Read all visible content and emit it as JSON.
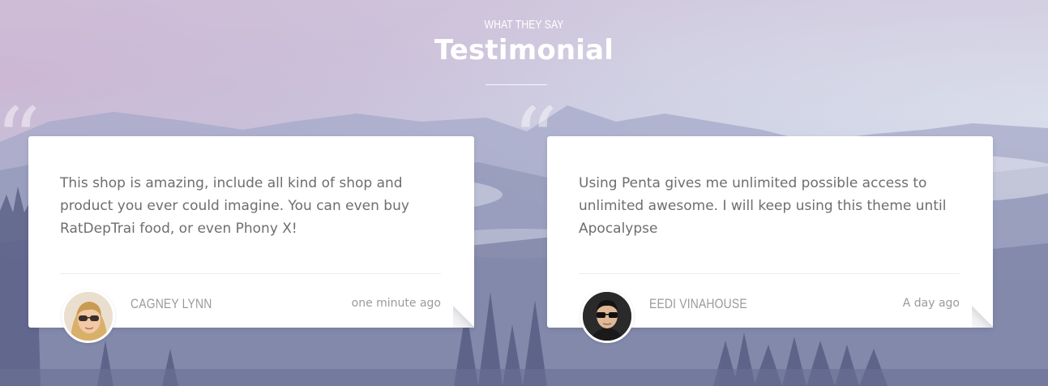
{
  "section": {
    "eyebrow": "WHAT THEY SAY",
    "title": "Testimonial"
  },
  "testimonials": [
    {
      "quote": "This shop is amazing, include all kind of shop and product you ever could imagine. You can even buy RatDepTrai food, or even Phony X!",
      "author": "CAGNEY LYNN",
      "time": "one minute ago",
      "avatar_icon": "woman-avatar"
    },
    {
      "quote": "Using Penta gives me unlimited possible access to unlimited awesome. I will keep using this theme until Apocalypse",
      "author": "EEDI VINAHOUSE",
      "time": "A day ago",
      "avatar_icon": "man-avatar"
    }
  ],
  "quote_glyph": "“",
  "colors": {
    "text": "#6e6e6e",
    "muted": "#9a9a9a",
    "card": "#ffffff"
  }
}
